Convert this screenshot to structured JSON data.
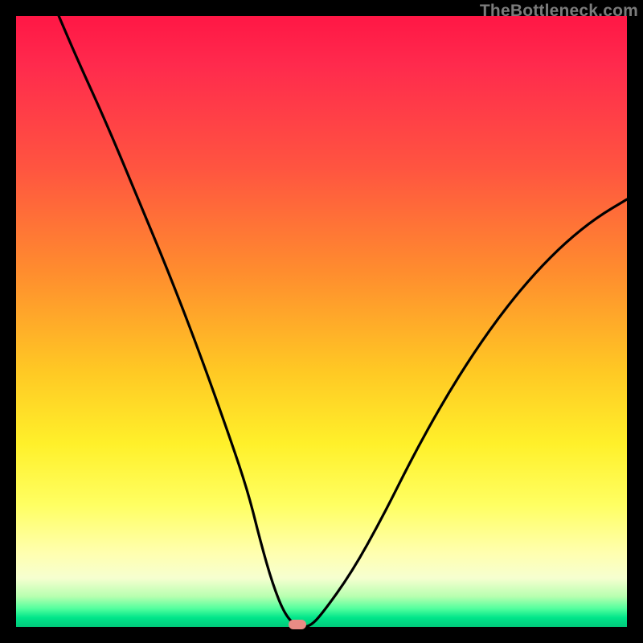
{
  "watermark": "TheBottleneck.com",
  "chart_data": {
    "type": "line",
    "title": "",
    "xlabel": "",
    "ylabel": "",
    "xlim": [
      0,
      100
    ],
    "ylim": [
      0,
      100
    ],
    "grid": false,
    "legend": false,
    "background_gradient": {
      "direction": "vertical",
      "stops": [
        {
          "pos": 0,
          "color": "#ff1745"
        },
        {
          "pos": 25,
          "color": "#ff5540"
        },
        {
          "pos": 50,
          "color": "#ffc824"
        },
        {
          "pos": 75,
          "color": "#fff02a"
        },
        {
          "pos": 95,
          "color": "#b8ffb0"
        },
        {
          "pos": 100,
          "color": "#00c97a"
        }
      ]
    },
    "series": [
      {
        "name": "bottleneck-curve",
        "color": "#000000",
        "x": [
          7,
          10,
          15,
          20,
          25,
          30,
          35,
          38,
          40,
          42,
          44,
          46,
          48,
          50,
          55,
          60,
          65,
          70,
          75,
          80,
          85,
          90,
          95,
          100
        ],
        "values": [
          100,
          93,
          82,
          70,
          58,
          45,
          31,
          22,
          14,
          7,
          2,
          0,
          0,
          2,
          9,
          18,
          28,
          37,
          45,
          52,
          58,
          63,
          67,
          70
        ]
      }
    ],
    "marker": {
      "name": "optimum-marker",
      "x": 46,
      "y": 0,
      "color": "#e98b85"
    }
  }
}
